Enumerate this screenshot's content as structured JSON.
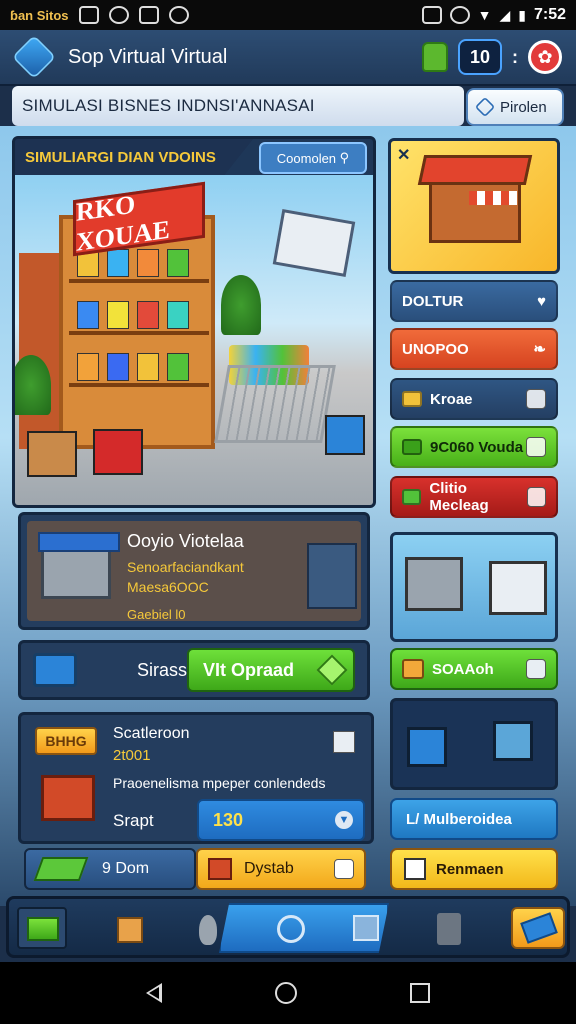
{
  "status_bar": {
    "carrier": "ɓan Sitos",
    "time": "7:52"
  },
  "app": {
    "title": "Sop Virtual Virtual",
    "counter": "10"
  },
  "banner": {
    "text": "SIMULASI BISNES INDNSI'ANNASAI",
    "profile_label": "Pirolen"
  },
  "scene": {
    "tag": "SIMULIARGI DIAN VDOINS",
    "button": "Coomolen",
    "shelf_sign": "RKO XOUAE"
  },
  "right_column": {
    "buttons": [
      {
        "label": "DOLTUR",
        "style": "blue"
      },
      {
        "label": "UNOPOO",
        "style": "orange"
      },
      {
        "label": "Kroae",
        "style": "dark"
      },
      {
        "label": "9C060 Vouda",
        "style": "green"
      },
      {
        "label": "Clitio Mecleag",
        "style": "red"
      }
    ],
    "green2_label": "SOAAoh",
    "blue2_label": "L/ Mulberoidea",
    "yellow_label": "Renmaen"
  },
  "info_card": {
    "title": "Ooyio Viotelaa",
    "line1": "Senoarfaciandkant",
    "line2": "Maesa6OOC",
    "line3": "Gaebiel l0"
  },
  "upgrade": {
    "label": "Sirass",
    "button": "VIt Opraad"
  },
  "order": {
    "badge": "BHHG",
    "title": "Scatleroon",
    "subtitle": "2t001",
    "description": "Praoenelisma mpeper conlendeds",
    "field_label": "Srapt",
    "field_value": "130"
  },
  "actions": {
    "left_label": "9 Dom",
    "right_label": "Dystab"
  },
  "colors": {
    "accent_yellow": "#f6c93a",
    "primary_blue": "#1e6cc0",
    "green": "#48b019",
    "red": "#d8312c"
  }
}
